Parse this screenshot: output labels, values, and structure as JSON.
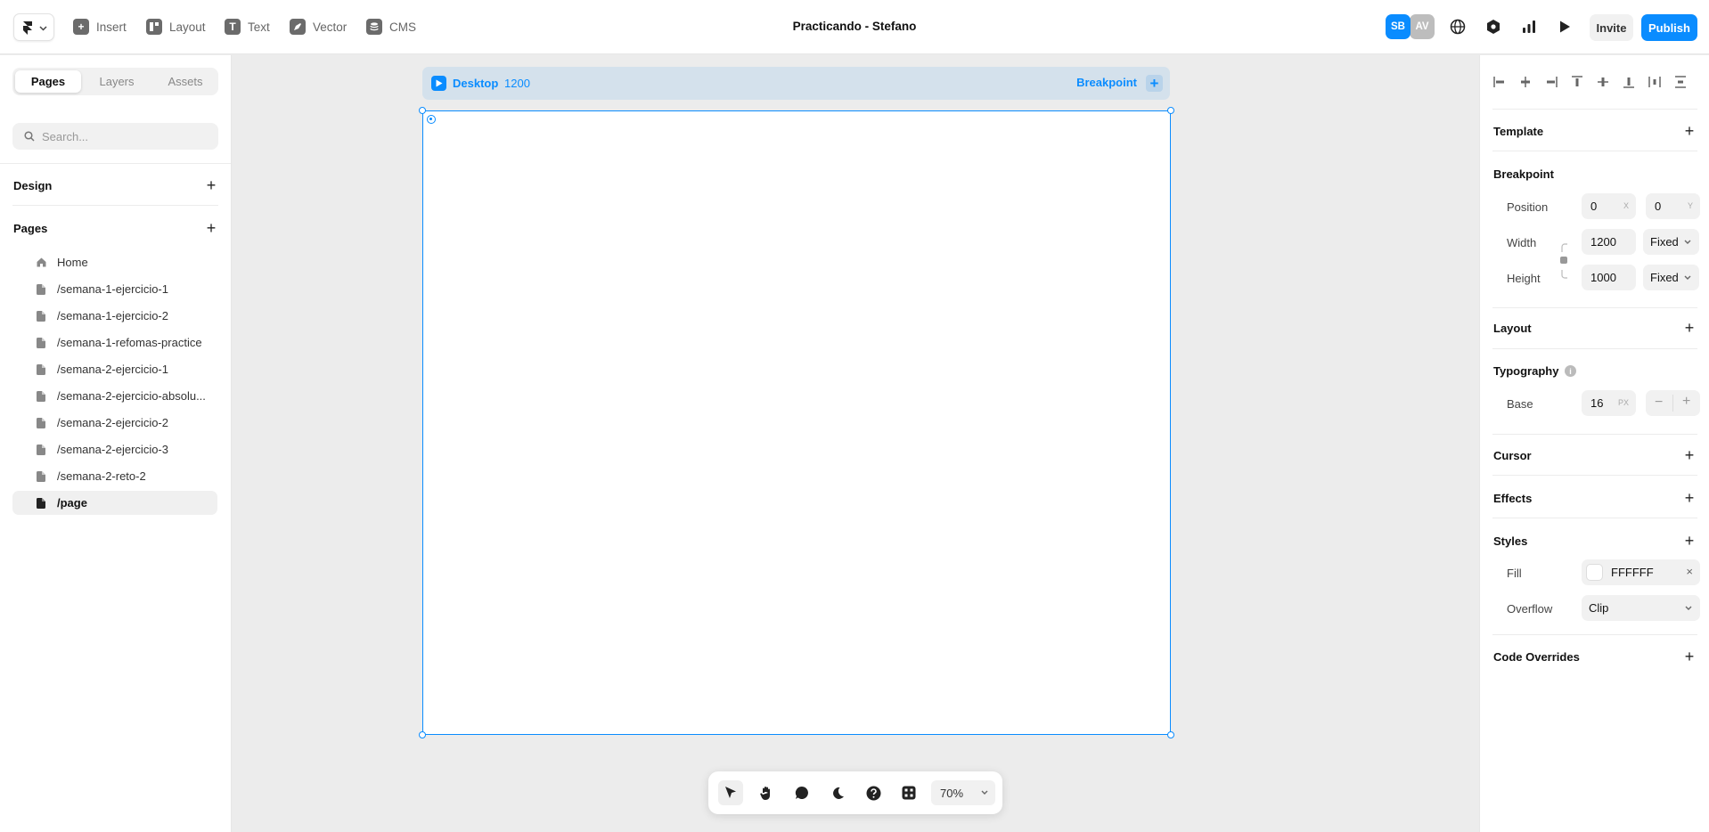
{
  "topbar": {
    "project_title": "Practicando - Stefano",
    "tools": [
      {
        "label": "Insert",
        "icon": "plus-square-icon"
      },
      {
        "label": "Layout",
        "icon": "layout-icon"
      },
      {
        "label": "Text",
        "icon": "text-icon"
      },
      {
        "label": "Vector",
        "icon": "pen-icon"
      },
      {
        "label": "CMS",
        "icon": "database-icon"
      }
    ],
    "avatars": [
      "SB",
      "AV"
    ],
    "invite_label": "Invite",
    "publish_label": "Publish",
    "accent_color": "#0a8cff"
  },
  "left_panel": {
    "tabs": [
      "Pages",
      "Layers",
      "Assets"
    ],
    "active_tab": "Pages",
    "search_placeholder": "Search...",
    "design_title": "Design",
    "pages_title": "Pages",
    "pages": [
      {
        "label": "Home",
        "icon": "home-icon"
      },
      {
        "label": "/semana-1-ejercicio-1",
        "icon": "page-icon"
      },
      {
        "label": "/semana-1-ejercicio-2",
        "icon": "page-icon"
      },
      {
        "label": "/semana-1-refomas-practice",
        "icon": "page-icon"
      },
      {
        "label": "/semana-2-ejercicio-1",
        "icon": "page-icon"
      },
      {
        "label": "/semana-2-ejercicio-absolu...",
        "icon": "page-icon"
      },
      {
        "label": "/semana-2-ejercicio-2",
        "icon": "page-icon"
      },
      {
        "label": "/semana-2-ejercicio-3",
        "icon": "page-icon"
      },
      {
        "label": "/semana-2-reto-2",
        "icon": "page-icon"
      },
      {
        "label": "/page",
        "icon": "page-icon",
        "active": true
      }
    ]
  },
  "canvas": {
    "breakpoint_name": "Desktop",
    "breakpoint_width": "1200",
    "add_breakpoint_label": "Breakpoint",
    "zoom": "70%"
  },
  "right_panel": {
    "template_title": "Template",
    "breakpoint_title": "Breakpoint",
    "position_label": "Position",
    "position_x": "0",
    "position_x_unit": "X",
    "position_y": "0",
    "position_y_unit": "Y",
    "width_label": "Width",
    "width_value": "1200",
    "width_mode": "Fixed",
    "height_label": "Height",
    "height_value": "1000",
    "height_mode": "Fixed",
    "layout_title": "Layout",
    "typography_title": "Typography",
    "base_label": "Base",
    "base_value": "16",
    "base_unit": "PX",
    "cursor_title": "Cursor",
    "effects_title": "Effects",
    "styles_title": "Styles",
    "fill_label": "Fill",
    "fill_value": "FFFFFF",
    "overflow_label": "Overflow",
    "overflow_value": "Clip",
    "code_overrides_title": "Code Overrides"
  }
}
